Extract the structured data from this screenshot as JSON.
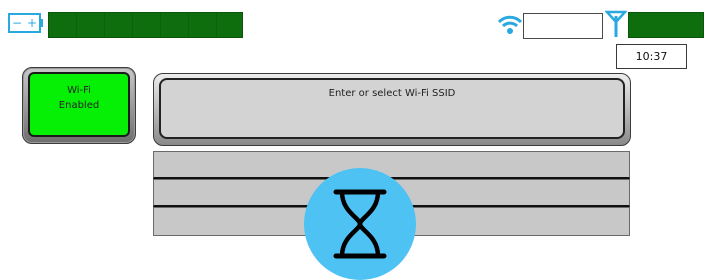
{
  "status_bar": {
    "battery_icon": "battery-icon",
    "battery_signs": {
      "minus": "−",
      "plus": "+"
    },
    "wifi_icon": "wifi-signal-icon",
    "antenna_icon": "antenna-icon",
    "clock": "10:37",
    "colors": {
      "level_fill": "#0e6e0e",
      "icon_blue": "#2aa8e0"
    }
  },
  "wifi_toggle": {
    "line1": "Wi-Fi",
    "line2": "Enabled",
    "color": "#06f006"
  },
  "ssid": {
    "placeholder": "Enter or select Wi-Fi SSID"
  },
  "network_list": {
    "rows": [
      "",
      "",
      ""
    ]
  },
  "busy": {
    "icon": "hourglass-icon",
    "color": "#4fc2f4"
  }
}
